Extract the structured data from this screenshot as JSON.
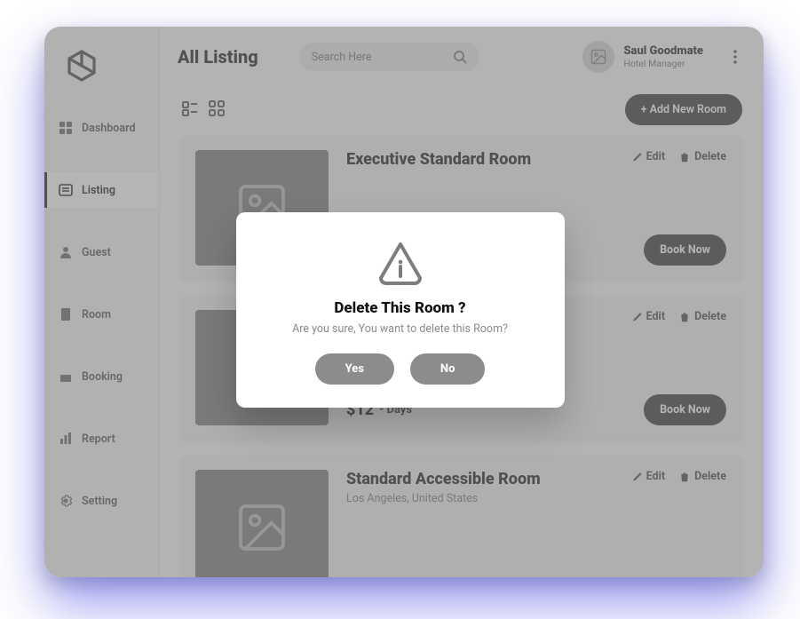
{
  "header": {
    "title": "All Listing",
    "search_placeholder": "Search Here",
    "user_name": "Saul Goodmate",
    "user_role": "Hotel Manager"
  },
  "sidebar": {
    "items": [
      {
        "label": "Dashboard"
      },
      {
        "label": "Listing"
      },
      {
        "label": "Guest"
      },
      {
        "label": "Room"
      },
      {
        "label": "Booking"
      },
      {
        "label": "Report"
      },
      {
        "label": "Setting"
      }
    ]
  },
  "toolbar": {
    "add_label": "+ Add New Room"
  },
  "listings": [
    {
      "title": "Executive Standard Room",
      "location": "",
      "price": "",
      "unit": "",
      "edit": "Edit",
      "del": "Delete",
      "book": "Book Now"
    },
    {
      "title": "",
      "location": "",
      "price": "$12",
      "unit": "- Days",
      "edit": "Edit",
      "del": "Delete",
      "book": "Book Now"
    },
    {
      "title": "Standard Accessible Room",
      "location": "Los Angeles, United States",
      "price": "",
      "unit": "",
      "edit": "Edit",
      "del": "Delete",
      "book": ""
    }
  ],
  "modal": {
    "title": "Delete This Room ?",
    "message": "Are you sure, You want to delete this Room?",
    "yes": "Yes",
    "no": "No"
  }
}
